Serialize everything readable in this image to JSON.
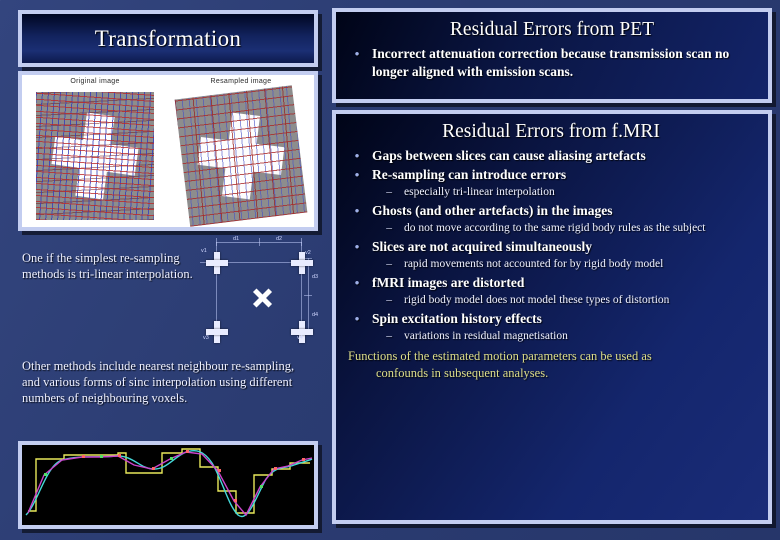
{
  "slide": {
    "left_panel": {
      "title": "Transformation",
      "figure": {
        "caption_left": "Original image",
        "caption_right": "Resampled image"
      },
      "text_block_1": "One if the simplest re-sampling methods is tri-linear interpolation.",
      "text_block_2": "Other methods include nearest neighbour re-sampling, and various forms of sinc interpolation using different numbers of neighbouring voxels.",
      "diagram_labels": {
        "v1": "v1",
        "v2": "v2",
        "v3": "v3",
        "v4": "v4",
        "d1": "d1",
        "d2": "d2",
        "d3": "d3",
        "d4": "d4"
      }
    },
    "right_panel": {
      "pet_section": {
        "heading": "Residual Errors from PET",
        "bullets": [
          {
            "level": 1,
            "marker": "•",
            "text": "Incorrect attenuation correction because transmission scan no longer aligned with emission scans."
          }
        ]
      },
      "fmri_section": {
        "heading": "Residual Errors from f.MRI",
        "bullets": [
          {
            "level": 1,
            "marker": "•",
            "text": "Gaps between slices can cause aliasing artefacts"
          },
          {
            "level": 1,
            "marker": "•",
            "text": "Re-sampling can introduce errors"
          },
          {
            "level": 2,
            "marker": "–",
            "text": "especially tri-linear interpolation"
          },
          {
            "level": 1,
            "marker": "•",
            "text": "Ghosts (and other artefacts) in the images"
          },
          {
            "level": 2,
            "marker": "–",
            "text": "do not move according to the same rigid body rules as the subject"
          },
          {
            "level": 1,
            "marker": "•",
            "text": "Slices are not acquired simultaneously"
          },
          {
            "level": 2,
            "marker": "–",
            "text": "rapid movements not accounted for by rigid body model"
          },
          {
            "level": 1,
            "marker": "•",
            "text": "fMRI images are distorted"
          },
          {
            "level": 2,
            "marker": "–",
            "text": "rigid body model does not model these types of distortion"
          },
          {
            "level": 1,
            "marker": "•",
            "text": "Spin excitation history effects"
          },
          {
            "level": 2,
            "marker": "–",
            "text": "variations in residual magnetisation"
          }
        ],
        "closing_line_1": "Functions of the estimated motion parameters can be used as",
        "closing_line_2": "confounds in subsequent analyses."
      }
    },
    "colors": {
      "background": "#2c3f76",
      "panel_border": "#c3cdf0",
      "panel_fill": "#0a1340",
      "heading_text": "#ffffff",
      "closing_text": "#ddde8a",
      "graph_nearest": "#e8e85a",
      "graph_linear": "#cc44cc",
      "graph_sinc": "#44d9d9"
    }
  }
}
